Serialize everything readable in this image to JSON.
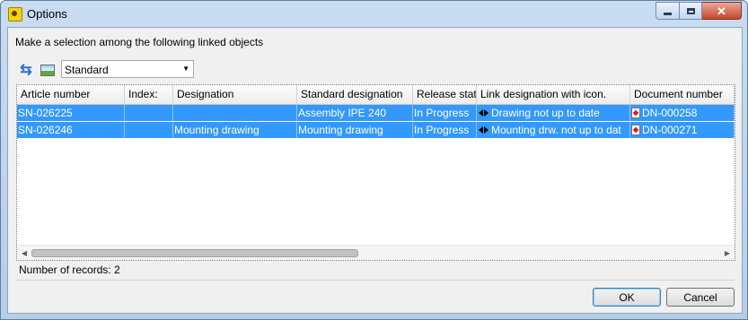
{
  "window": {
    "title": "Options"
  },
  "instruction": "Make a selection among the following linked objects",
  "toolbar": {
    "view_select": {
      "value": "Standard"
    }
  },
  "table": {
    "columns": [
      "Article number",
      "Index:",
      "Designation",
      "Standard designation",
      "Release stat",
      "Link designation with icon.",
      "Document number"
    ],
    "rows": [
      {
        "article_number": "SN-026225",
        "index": "",
        "designation": "",
        "standard_designation": "Assembly IPE 240",
        "release_status": "In Progress",
        "link_designation": "Drawing not up to date",
        "document_number": "DN-000258"
      },
      {
        "article_number": "SN-026246",
        "index": "",
        "designation": "Mounting drawing",
        "standard_designation": "Mounting drawing",
        "release_status": "In Progress",
        "link_designation": "Mounting drw. not up to dat",
        "document_number": "DN-000271"
      }
    ]
  },
  "status": {
    "records": "Number of records: 2"
  },
  "buttons": {
    "ok": "OK",
    "cancel": "Cancel"
  },
  "colors": {
    "selection": "#3399ff",
    "title_bar": "#c9dcf0",
    "close_button": "#c6462e"
  },
  "icons": {
    "refresh": "refresh-icon",
    "image": "image-icon",
    "link": "link-icon",
    "document": "pdf-icon"
  }
}
